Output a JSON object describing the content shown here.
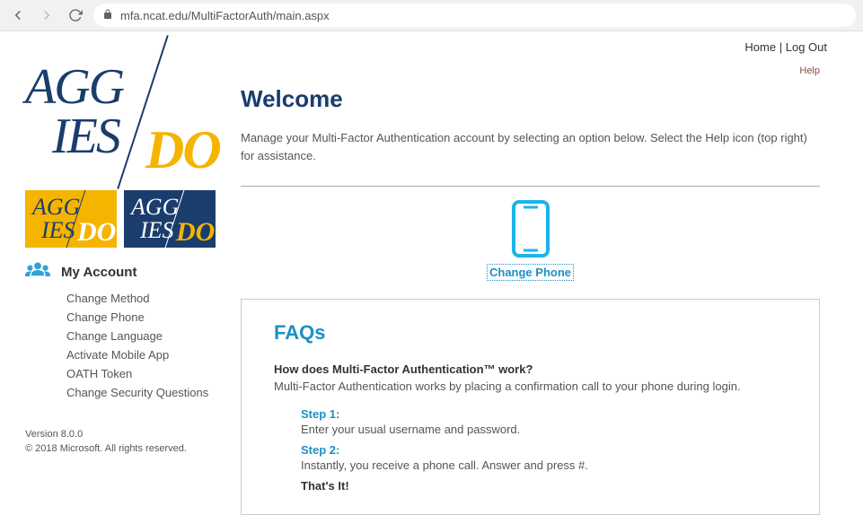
{
  "browser": {
    "url": "mfa.ncat.edu/MultiFactorAuth/main.aspx"
  },
  "topnav": {
    "home": "Home",
    "logout": "Log Out",
    "help": "Help"
  },
  "logo": {
    "part1": "AGG",
    "part2": "IES",
    "part3": "DO"
  },
  "sidebar": {
    "account_label": "My Account",
    "items": [
      "Change Method",
      "Change Phone",
      "Change Language",
      "Activate Mobile App",
      "OATH Token",
      "Change Security Questions"
    ],
    "version": "Version 8.0.0",
    "copyright": "© 2018 Microsoft. All rights reserved."
  },
  "main": {
    "heading": "Welcome",
    "description": "Manage your Multi-Factor Authentication account by selecting an option below. Select the Help icon (top right) for assistance.",
    "change_phone": "Change Phone"
  },
  "faq": {
    "heading": "FAQs",
    "q1": "How does Multi-Factor Authentication™ work?",
    "a1": "Multi-Factor Authentication works by placing a confirmation call to your phone during login.",
    "step1_label": "Step 1:",
    "step1_text": "Enter your usual username and password.",
    "step2_label": "Step 2:",
    "step2_text": "Instantly, you receive a phone call. Answer and press #.",
    "final": "That's It!"
  }
}
